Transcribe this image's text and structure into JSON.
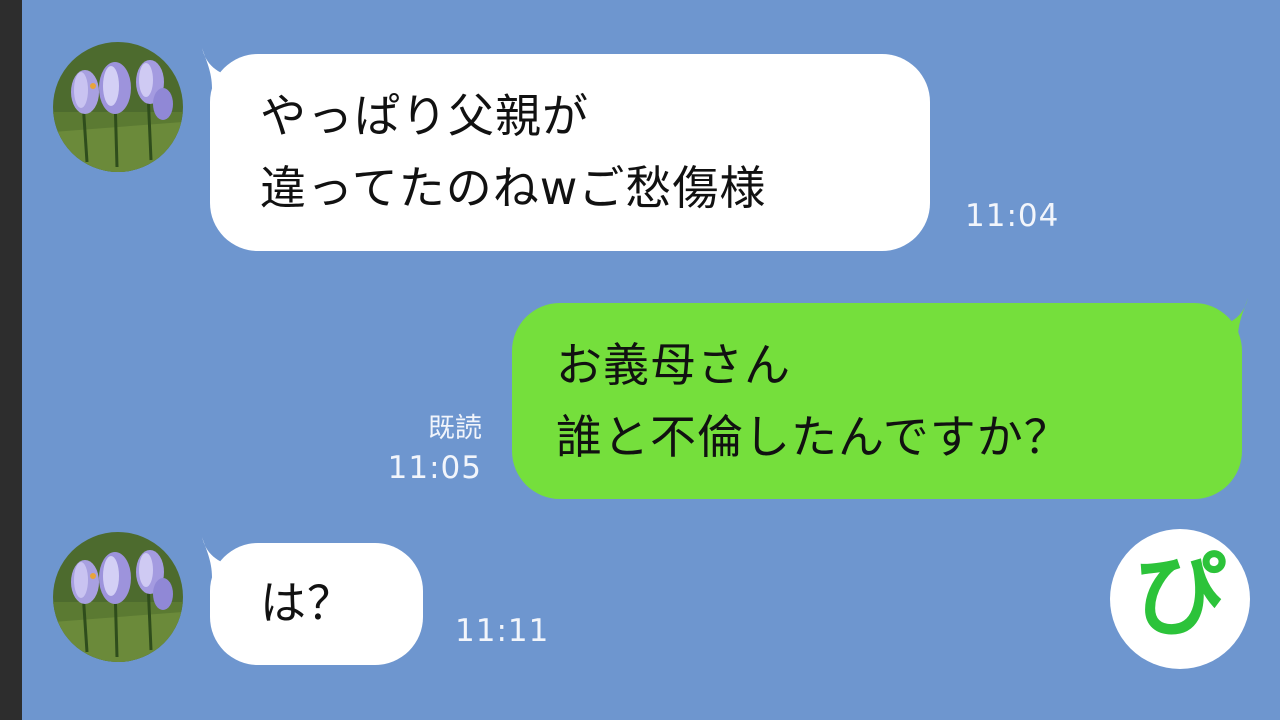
{
  "theme": {
    "background": "#6e96cf",
    "incoming_bubble": "#ffffff",
    "outgoing_bubble": "#75df3c",
    "logo_color": "#2cc33a"
  },
  "messages": [
    {
      "direction": "incoming",
      "lines": [
        "やっぱり父親が",
        "違ってたのねwご愁傷様"
      ],
      "time": "11:04",
      "avatar": "crocus-flower-avatar"
    },
    {
      "direction": "outgoing",
      "lines": [
        "お義母さん",
        "誰と不倫したんですか？"
      ],
      "read": "既読",
      "time": "11:05"
    },
    {
      "direction": "incoming",
      "lines": [
        "は？"
      ],
      "time": "11:11",
      "avatar": "crocus-flower-avatar"
    }
  ],
  "logo": {
    "text": "ぴ",
    "icon": "channel-logo-icon"
  }
}
